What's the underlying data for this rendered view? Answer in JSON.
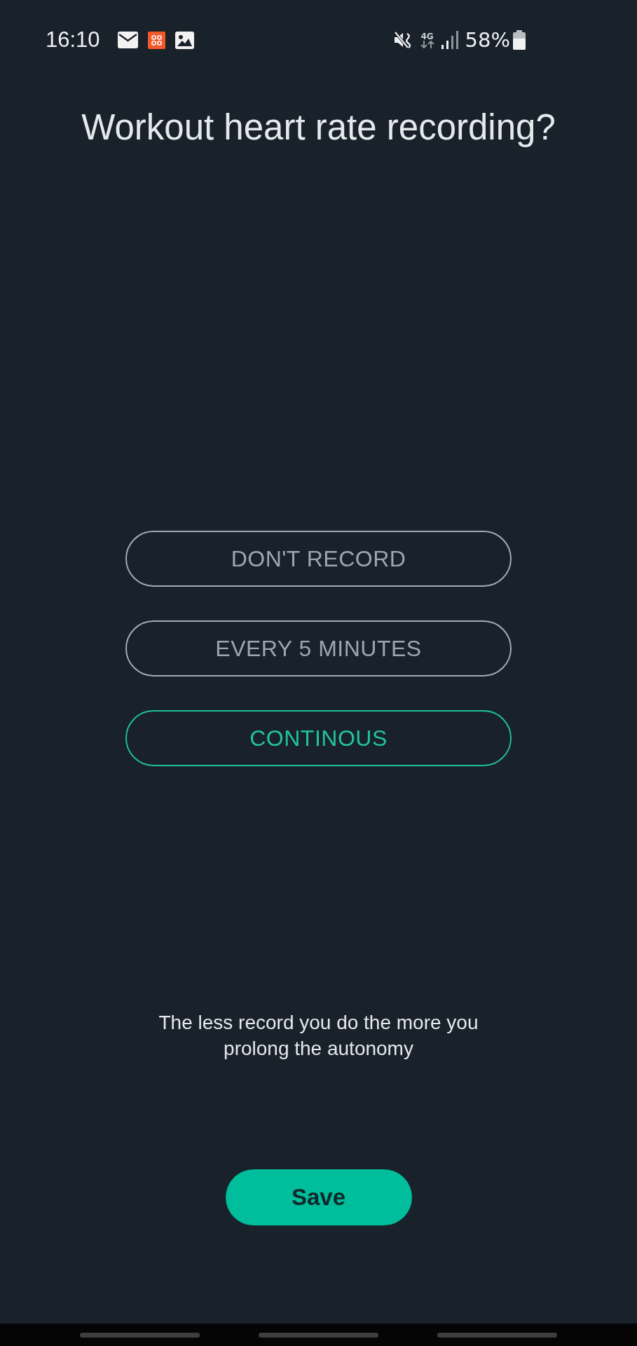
{
  "status_bar": {
    "time": "16:10",
    "network": "4G",
    "battery": "58%"
  },
  "title": "Workout heart rate recording?",
  "options": [
    {
      "label": "DON'T RECORD",
      "selected": false
    },
    {
      "label": "EVERY 5 MINUTES",
      "selected": false
    },
    {
      "label": "CONTINOUS",
      "selected": true
    }
  ],
  "hint": "The less record you do the more you prolong the autonomy",
  "save_button": "Save"
}
